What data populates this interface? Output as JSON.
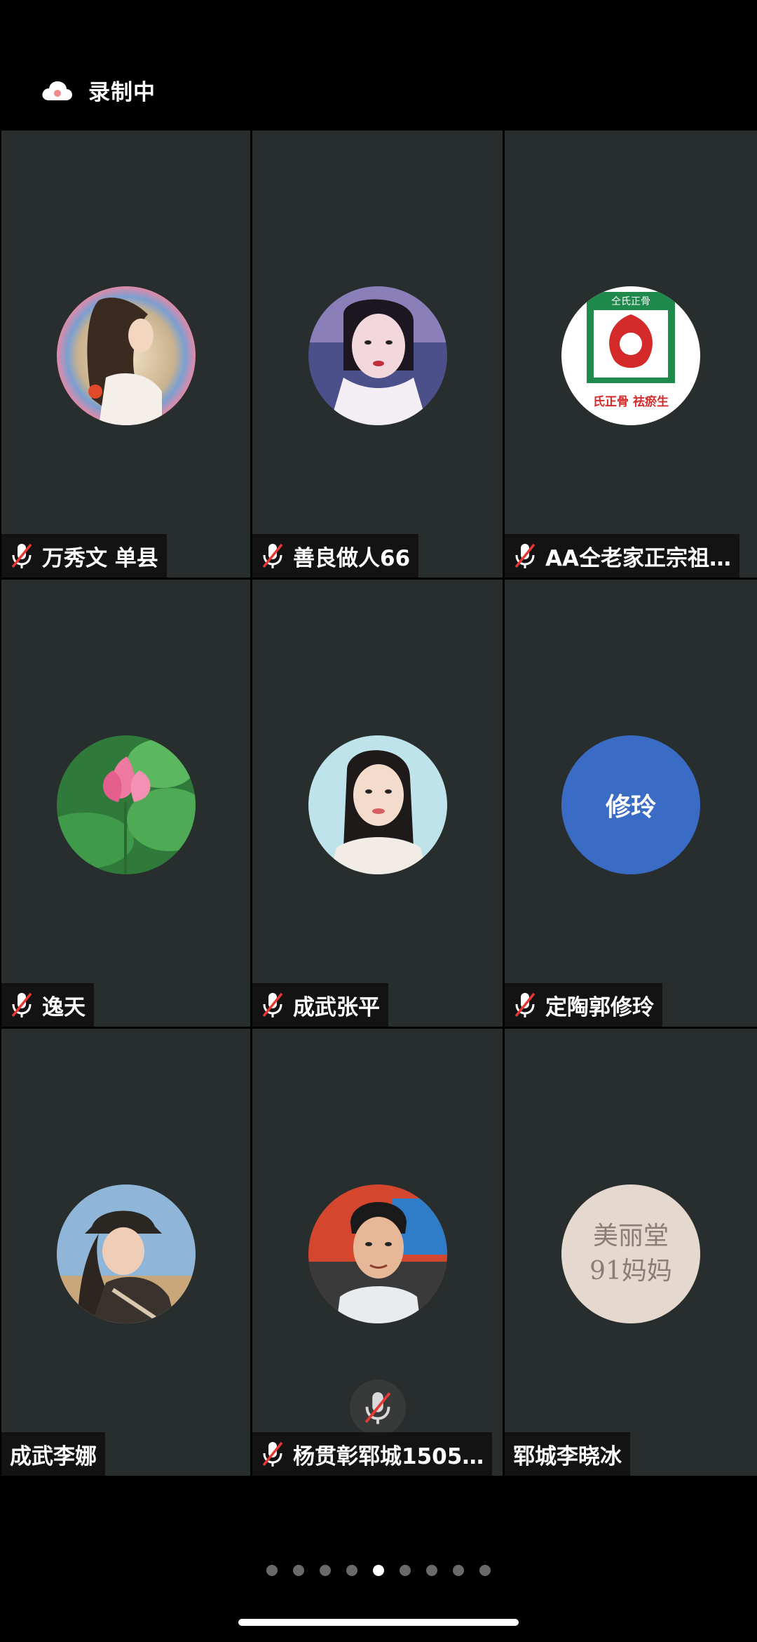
{
  "status": {
    "recording_label": "录制中",
    "cloud_icon": "cloud-recording-icon"
  },
  "participants": [
    {
      "name": "万秀文 单县",
      "muted": true,
      "avatar": "photo-woman-profile"
    },
    {
      "name": "善良做人66",
      "muted": true,
      "avatar": "photo-woman-face"
    },
    {
      "name": "AA仝老家正宗祖…",
      "muted": true,
      "avatar": "logo-seal",
      "avatar_text": [
        "仝氏正骨",
        "氏正骨 祛瘀生"
      ]
    },
    {
      "name": "逸天",
      "muted": true,
      "avatar": "photo-lotus"
    },
    {
      "name": "成武张平",
      "muted": true,
      "avatar": "photo-woman-portrait"
    },
    {
      "name": "定陶郭修玲",
      "muted": true,
      "avatar": "initials",
      "initials": "修玲"
    },
    {
      "name": "成武李娜",
      "muted": false,
      "avatar": "photo-woman-hat"
    },
    {
      "name": "杨贯彰郓城1505…",
      "muted": true,
      "avatar": "photo-man-face",
      "center_mic": "muted-mic-icon"
    },
    {
      "name": "郓城李晓冰",
      "muted": false,
      "avatar": "handwriting-plate",
      "avatar_text": [
        "美丽堂",
        "91妈妈"
      ]
    }
  ],
  "pager": {
    "count": 9,
    "active": 5
  },
  "colors": {
    "tile_bg": "#282d2d",
    "initials_bg": "#3a6cc6",
    "mute_red": "#e53935"
  }
}
